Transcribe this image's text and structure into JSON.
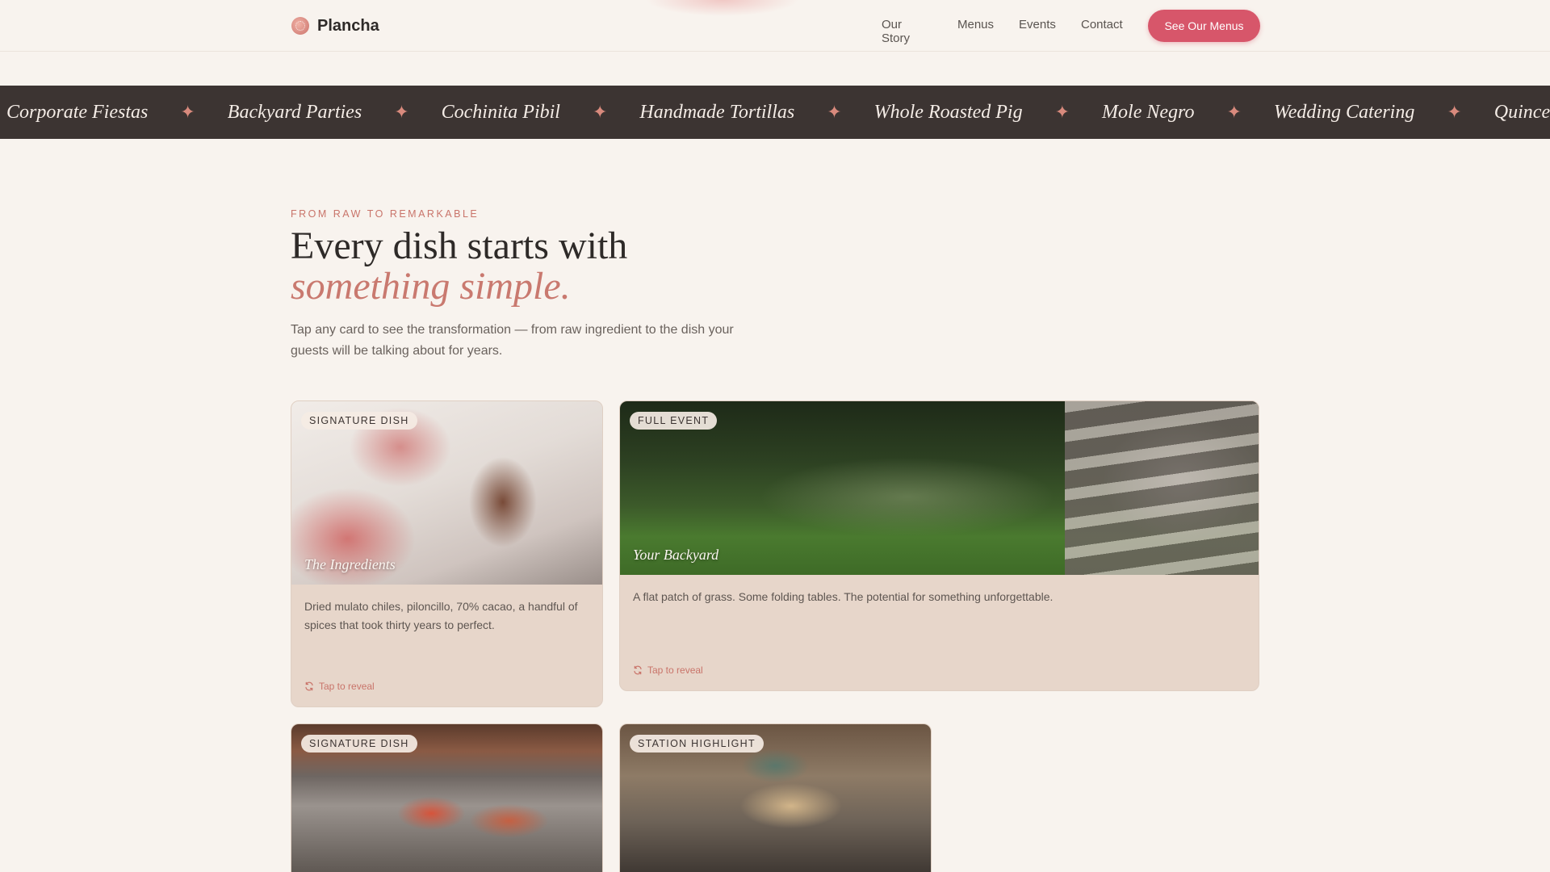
{
  "header": {
    "brand": "Plancha",
    "nav": [
      "Our Story",
      "Menus",
      "Events",
      "Contact"
    ],
    "cta": "See Our Menus"
  },
  "marquee": {
    "items": [
      "Corporate Fiestas",
      "Backyard Parties",
      "Cochinita Pibil",
      "Handmade Tortillas",
      "Whole Roasted Pig",
      "Mole Negro",
      "Wedding Catering",
      "Quinceañeras"
    ],
    "separator": "✦"
  },
  "intro": {
    "eyebrow": "FROM RAW TO REMARKABLE",
    "headline_line1": "Every dish starts with",
    "headline_line2": "something simple.",
    "description": "Tap any card to see the transformation — from raw ingredient to the dish your guests will be talking about for years."
  },
  "cards": [
    {
      "tag": "SIGNATURE DISH",
      "caption": "The Ingredients",
      "body": "Dried mulato chiles, piloncillo, 70% cacao, a handful of spices that took thirty years to perfect.",
      "reveal": "Tap to reveal"
    },
    {
      "tag": "FULL EVENT",
      "caption": "Your Backyard",
      "body": "A flat patch of grass. Some folding tables. The potential for something unforgettable.",
      "reveal": "Tap to reveal"
    },
    {
      "tag": "SIGNATURE DISH"
    },
    {
      "tag": "STATION HIGHLIGHT"
    }
  ],
  "colors": {
    "background": "#f8f3ee",
    "accent": "#d7566a",
    "marquee_bg": "#3c3432",
    "card_bg": "#e7d6ca"
  }
}
